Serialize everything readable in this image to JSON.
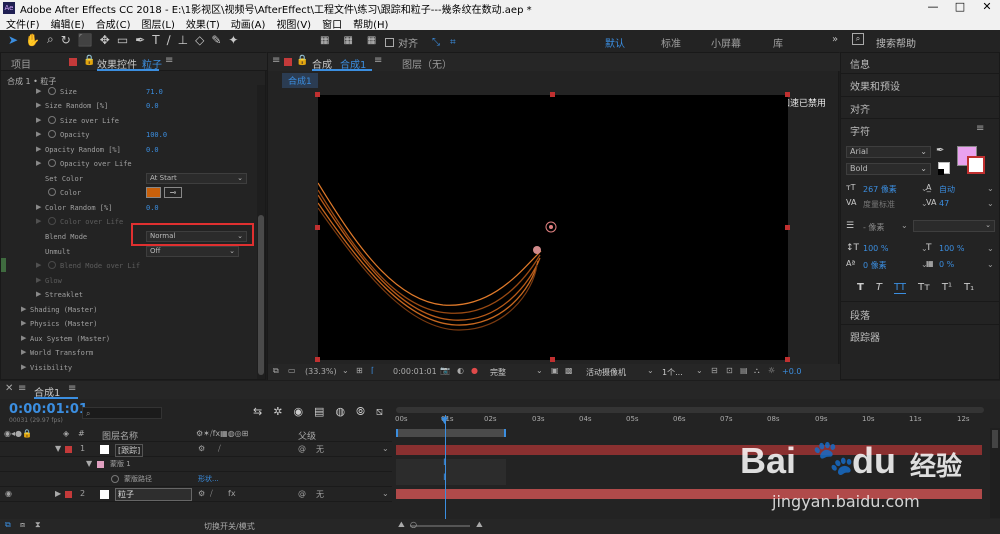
{
  "window": {
    "app_icon": "Ae",
    "title": "Adobe After Effects CC 2018 - E:\\1影视区\\视频号\\AfterEffect\\工程文件\\练习\\跟踪和粒子---幾条纹在数动.aep *",
    "min": "—",
    "max": "□",
    "close": "✕"
  },
  "menu": [
    "文件(F)",
    "编辑(E)",
    "合成(C)",
    "图层(L)",
    "效果(T)",
    "动画(A)",
    "视图(V)",
    "窗口",
    "帮助(H)"
  ],
  "toolbar": {
    "snap_label": "对齐",
    "workspaces": [
      "默认",
      "标准",
      "小屏幕",
      "库"
    ],
    "search_placeholder": "搜索帮助"
  },
  "left_panel": {
    "tab_project": "项目",
    "tab_effects": "效果控件",
    "tab_effects_layer": "粒子",
    "breadcrumb": "合成 1 • 粒子",
    "props": [
      {
        "label": "Size",
        "value": "71.0"
      },
      {
        "label": "Size Random [%]",
        "value": "0.0"
      },
      {
        "label": "Size over Life",
        "value": ""
      },
      {
        "label": "Opacity",
        "value": "100.0"
      },
      {
        "label": "Opacity Random [%]",
        "value": "0.0"
      },
      {
        "label": "Opacity over Life",
        "value": ""
      },
      {
        "label": "Set Color",
        "value": "At Start"
      },
      {
        "label": "Color",
        "value": ""
      },
      {
        "label": "Color Random [%]",
        "value": "0.0"
      },
      {
        "label": "Color over Life",
        "value": ""
      },
      {
        "label": "Blend Mode",
        "value": "Normal"
      },
      {
        "label": "Unmult",
        "value": "Off"
      },
      {
        "label": "Blend Mode over Lif",
        "value": ""
      },
      {
        "label": "Glow",
        "value": ""
      },
      {
        "label": "Streaklet",
        "value": ""
      },
      {
        "label": "Shading (Master)",
        "value": ""
      },
      {
        "label": "Physics (Master)",
        "value": ""
      },
      {
        "label": "Aux System (Master)",
        "value": ""
      },
      {
        "label": "World Transform",
        "value": ""
      },
      {
        "label": "Visibility",
        "value": ""
      }
    ],
    "color_swatch": "#c8600b",
    "highlight_color": "#e03030"
  },
  "viewer": {
    "tab_comp": "合成",
    "tab_comp_name": "合成1",
    "tab_layer": "图层（无）",
    "subtab": "合成1",
    "gpu_notice": "显示加速已禁用",
    "zoom": "(33.3%)",
    "timecode": "0:00:01:01",
    "quality": "完整",
    "camera": "活动摄像机",
    "views": "1个...",
    "exposure": "+0.0"
  },
  "right_panel": {
    "items": [
      "信息",
      "效果和预设",
      "对齐"
    ],
    "char_title": "字符",
    "font": "Arial",
    "style": "Bold",
    "font_size": "267 像素",
    "leading": "自动",
    "kerning": "度量标准",
    "tracking": "47",
    "stroke": "- 像素",
    "vscale": "100 %",
    "hscale": "100 %",
    "baseline": "0 像素",
    "tsume": "0 %",
    "text_styles": [
      "T",
      "T",
      "TT",
      "Tт",
      "T¹",
      "T₁"
    ],
    "paragraph": "段落",
    "tracker": "跟踪器",
    "fill_color": "#e9a2ee"
  },
  "timeline": {
    "tab": "合成1",
    "timecode": "0:00:01:01",
    "fps": "00031 (29.97 fps)",
    "search_placeholder": "",
    "col_layer_name": "图层名称",
    "col_parent": "父级",
    "ruler": [
      "00s",
      "01s",
      "02s",
      "03s",
      "04s",
      "05s",
      "06s",
      "07s",
      "08s",
      "09s",
      "10s",
      "11s",
      "12s"
    ],
    "layers": [
      {
        "num": "1",
        "name": "[跟踪]",
        "parent": "无",
        "color": "#c43a3a"
      },
      {
        "num": "",
        "name": "蒙版 1",
        "parent": "",
        "color": "#e0a0c0"
      },
      {
        "num": "",
        "name": "蒙版路径",
        "parent": "",
        "value": "形状..."
      },
      {
        "num": "2",
        "name": "粒子",
        "parent": "无",
        "color": "#c43a3a"
      }
    ],
    "footer": "切换开关/模式"
  },
  "watermark": {
    "brand": "Bai",
    "paw": "🐾",
    "brand2": "du",
    "cn": "经验",
    "url": "jingyan.baidu.com"
  }
}
